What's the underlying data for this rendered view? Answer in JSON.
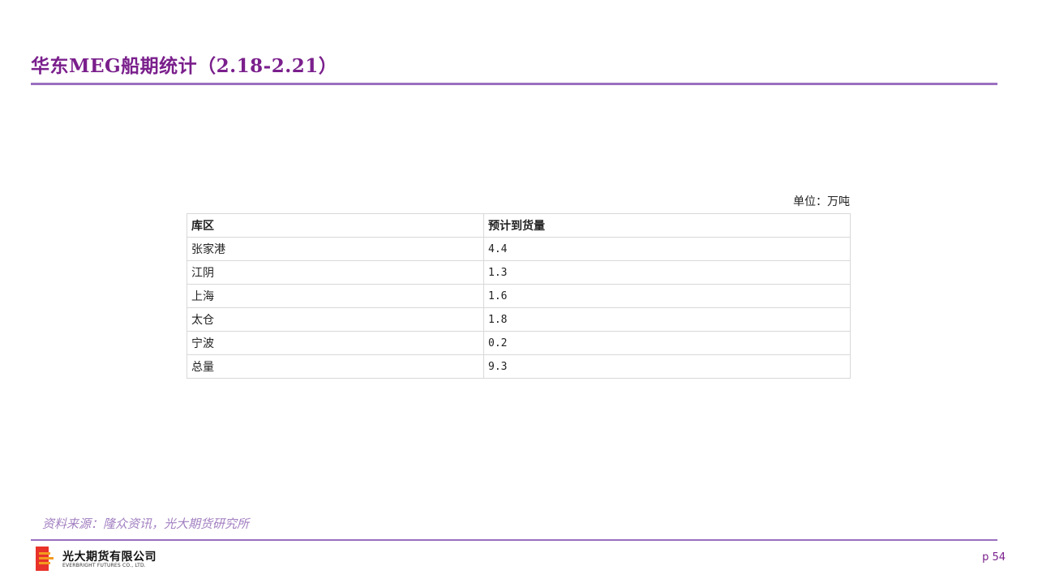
{
  "title": "华东MEG船期统计（2.18-2.21）",
  "unit_note": "单位：万吨",
  "table": {
    "headers": [
      "库区",
      "预计到货量"
    ],
    "rows": [
      [
        "张家港",
        "4.4"
      ],
      [
        "江阴",
        "1.3"
      ],
      [
        "上海",
        "1.6"
      ],
      [
        "太仓",
        "1.8"
      ],
      [
        "宁波",
        "0.2"
      ],
      [
        "总量",
        "9.3"
      ]
    ]
  },
  "source": "资料来源：隆众资讯，光大期货研究所",
  "footer": {
    "logo_cn": "光大期货有限公司",
    "logo_en": "EVERBRIGHT FUTURES CO., LTD.",
    "page": "p 54"
  },
  "colors": {
    "accent": "#7a1f8c",
    "rule": "#9b6fc0",
    "source_text": "#a27fc1",
    "logo_red": "#e8322a",
    "logo_orange": "#f39a1e"
  }
}
